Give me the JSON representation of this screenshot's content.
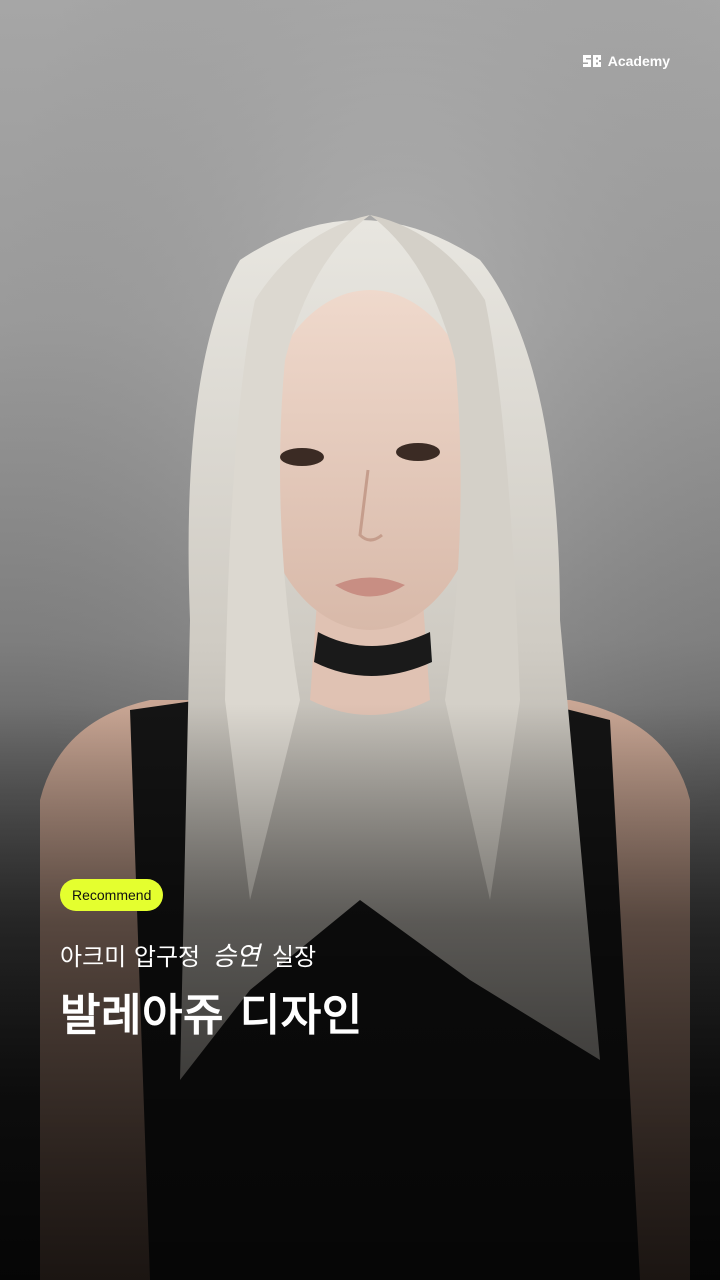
{
  "brand": {
    "logo": "sb-logo-icon",
    "name": "Academy"
  },
  "badge": {
    "label": "Recommend",
    "color": "#E4FF2F"
  },
  "subtitle": {
    "prefix": "아크미 압구정",
    "script_name": "승연",
    "suffix": "실장"
  },
  "title": "발레아쥬 디자인",
  "image": {
    "subject": "portrait-photo"
  }
}
